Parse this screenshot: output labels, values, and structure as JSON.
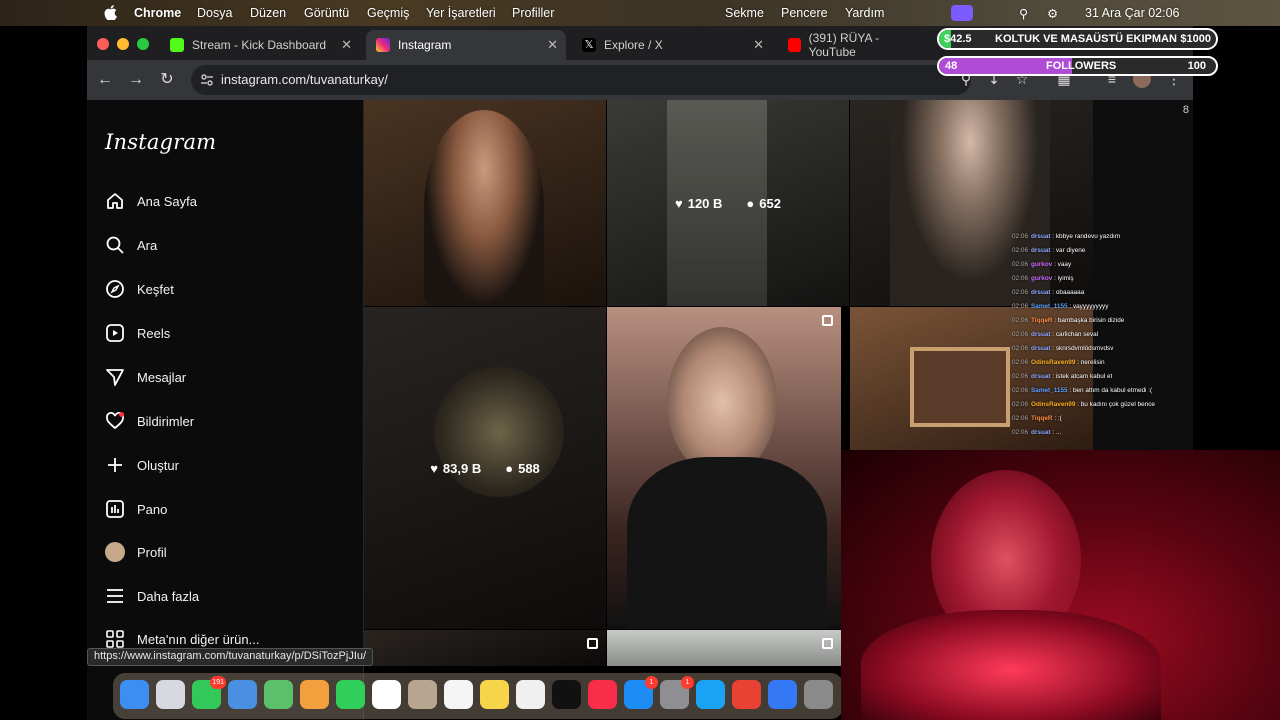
{
  "menubar": {
    "app_name": "Chrome",
    "items": [
      "Dosya",
      "Düzen",
      "Görüntü",
      "Geçmiş",
      "Yer İşaretleri",
      "Profiller",
      "Sekme",
      "Pencere",
      "Yardım"
    ],
    "clock": "31 Ara Çar  02:06"
  },
  "tabs": [
    {
      "title": "Stream - Kick Dashboard",
      "favicon": "kick-icon",
      "color": "#53fc18"
    },
    {
      "title": "Instagram",
      "favicon": "instagram-icon",
      "color": "#d62976"
    },
    {
      "title": "Explore / X",
      "favicon": "x-icon",
      "color": "#ffffff"
    },
    {
      "title": "(391) RÜYA - YouTube",
      "favicon": "youtube-icon",
      "color": "#ff0000"
    }
  ],
  "toolbar": {
    "url": "instagram.com/tuvanaturkay/"
  },
  "instagram": {
    "logo": "Instagram",
    "nav": [
      {
        "label": "Ana Sayfa",
        "icon": "home-icon"
      },
      {
        "label": "Ara",
        "icon": "search-icon"
      },
      {
        "label": "Keşfet",
        "icon": "compass-icon"
      },
      {
        "label": "Reels",
        "icon": "reels-icon"
      },
      {
        "label": "Mesajlar",
        "icon": "messages-icon"
      },
      {
        "label": "Bildirimler",
        "icon": "heart-icon"
      },
      {
        "label": "Oluştur",
        "icon": "plus-icon"
      },
      {
        "label": "Pano",
        "icon": "dashboard-icon"
      },
      {
        "label": "Profil",
        "icon": "avatar"
      },
      {
        "label": "Daha fazla",
        "icon": "menu-icon"
      },
      {
        "label": "Meta'nın diğer ürün...",
        "icon": "apps-icon"
      }
    ],
    "posts": [
      {
        "likes": "",
        "comments": "",
        "multi": false,
        "colors": [
          "#3b2a1c",
          "#1a120c"
        ]
      },
      {
        "likes": "120 B",
        "comments": "652",
        "multi": false,
        "colors": [
          "#4a4a46",
          "#1e1e1c"
        ]
      },
      {
        "likes": "",
        "comments": "",
        "multi": false,
        "colors": [
          "#2a2622",
          "#0f0d0c"
        ]
      },
      {
        "likes": "83,9 B",
        "comments": "588",
        "multi": false,
        "colors": [
          "#3a3430",
          "#161311"
        ]
      },
      {
        "likes": "",
        "comments": "",
        "multi": true,
        "colors": [
          "#b08c7a",
          "#2a1a18"
        ]
      },
      {
        "likes": "",
        "comments": "",
        "multi": false,
        "colors": [
          "#6a4a30",
          "#2b1a10"
        ]
      },
      {
        "likes": "",
        "comments": "",
        "multi": true,
        "colors": [
          "#2a2420",
          "#0c0a09"
        ]
      },
      {
        "likes": "",
        "comments": "",
        "multi": true,
        "colors": [
          "#c8cac8",
          "#8a8c8a"
        ]
      }
    ],
    "scroll_indicator": "8"
  },
  "status_url": "https://www.instagram.com/tuvanaturkay/p/DSiTozPjJIu/",
  "chat": [
    {
      "time": "02:06",
      "user": "drsuat",
      "color": "#8aa6ff",
      "msg": "kbbye randevu yazdım"
    },
    {
      "time": "02:06",
      "user": "drsuat",
      "color": "#8aa6ff",
      "msg": "var diyene"
    },
    {
      "time": "02:06",
      "user": "gurkov",
      "color": "#c86bff",
      "msg": "vaay"
    },
    {
      "time": "02:06",
      "user": "gurkov",
      "color": "#c86bff",
      "msg": "iyimiş"
    },
    {
      "time": "02:06",
      "user": "drsuat",
      "color": "#8aa6ff",
      "msg": "obaaaaaa"
    },
    {
      "time": "02:06",
      "user": "Samet_1155",
      "color": "#5aa0ff",
      "msg": "vayyyyyyyyy"
    },
    {
      "time": "02:06",
      "user": "TiqqeR",
      "color": "#ff8c42",
      "msg": "bambaşka birisin dizide"
    },
    {
      "time": "02:06",
      "user": "drsuat",
      "color": "#8aa6ff",
      "msg": "carlichan seval"
    },
    {
      "time": "02:06",
      "user": "drsuat",
      "color": "#8aa6ff",
      "msg": "sknrsdvmlödsmvdsv"
    },
    {
      "time": "02:06",
      "user": "OdinsRaven99",
      "color": "#ffb020",
      "msg": "nerelisin"
    },
    {
      "time": "02:06",
      "user": "drsuat",
      "color": "#8aa6ff",
      "msg": "istek atcam kabul et"
    },
    {
      "time": "02:06",
      "user": "Samet_1155",
      "color": "#5aa0ff",
      "msg": "ben attım da kabul etmedi :("
    },
    {
      "time": "02:06",
      "user": "OdinsRaven99",
      "color": "#ffb020",
      "msg": "bu kadını çok güzel bence"
    },
    {
      "time": "02:06",
      "user": "TiqqeR",
      "color": "#ff8c42",
      "msg": ":("
    },
    {
      "time": "02:06",
      "user": "drsuat",
      "color": "#8aa6ff",
      "msg": "..."
    }
  ],
  "goal": {
    "current": "$42.5",
    "title": "KOLTUK VE MASAÜSTÜ EKIPMAN",
    "target": "$1000",
    "progress_fraction": 0.0425
  },
  "followers_goal": {
    "current": "48",
    "title": "FOLLOWERS",
    "target": "100",
    "progress_fraction": 0.48
  },
  "dock": [
    {
      "name": "finder-icon",
      "color": "#3d8ef0",
      "badge": ""
    },
    {
      "name": "launchpad-icon",
      "color": "#d8d8e0",
      "badge": ""
    },
    {
      "name": "messages-app-icon",
      "color": "#34c759",
      "badge": "191"
    },
    {
      "name": "mail-icon",
      "color": "#4a90e2",
      "badge": ""
    },
    {
      "name": "maps-icon",
      "color": "#5cc06a",
      "badge": ""
    },
    {
      "name": "photos-icon",
      "color": "#f2a03d",
      "badge": ""
    },
    {
      "name": "facetime-icon",
      "color": "#2fcf5a",
      "badge": ""
    },
    {
      "name": "calendar-icon",
      "color": "#ffffff",
      "badge": ""
    },
    {
      "name": "contacts-icon",
      "color": "#b8a690",
      "badge": ""
    },
    {
      "name": "reminders-icon",
      "color": "#f5f5f5",
      "badge": ""
    },
    {
      "name": "notes-icon",
      "color": "#f7d54a",
      "badge": ""
    },
    {
      "name": "freeform-icon",
      "color": "#f0f0f0",
      "badge": ""
    },
    {
      "name": "appletv-icon",
      "color": "#111111",
      "badge": ""
    },
    {
      "name": "music-icon",
      "color": "#fa2d48",
      "badge": ""
    },
    {
      "name": "appstore-icon",
      "color": "#1e8cf5",
      "badge": "1"
    },
    {
      "name": "settings-icon",
      "color": "#8e8e93",
      "badge": "1"
    },
    {
      "name": "safari-icon",
      "color": "#1aa3f5",
      "badge": ""
    },
    {
      "name": "chrome-icon",
      "color": "#e94235",
      "badge": ""
    },
    {
      "name": "simulator-icon",
      "color": "#3478f6",
      "badge": ""
    },
    {
      "name": "preview-icon",
      "color": "#8a8a8a",
      "badge": ""
    }
  ]
}
